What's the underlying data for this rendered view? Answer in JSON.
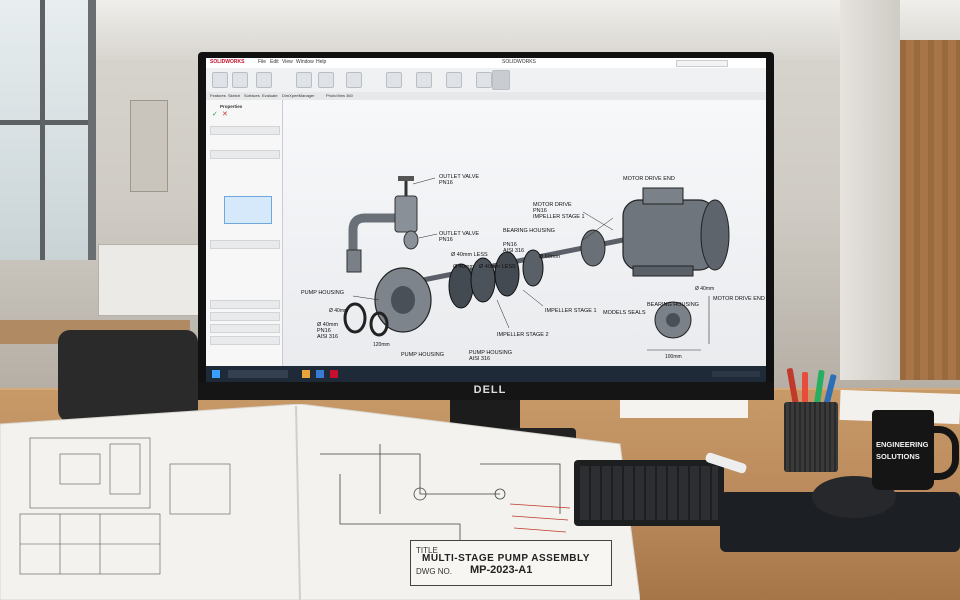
{
  "screen": {
    "app_logo": "SOLIDWORKS",
    "window_title": "SOLIDWORKS",
    "menu": [
      "File",
      "Edit",
      "View",
      "Window",
      "Help"
    ],
    "tabs": [
      "Features",
      "Sketch",
      "Surfaces",
      "Evaluate",
      "DimXpertManager",
      "PhotoView 360"
    ],
    "panel_title": "Properties",
    "callouts": [
      "OUTLET VALVE\nPN16",
      "OUTLET VALVE\nPN16",
      "MOTOR DRIVE END",
      "MOTOR DRIVE\nPN16\nIMPELLER STAGE 1",
      "BEARING HOUSING",
      "PN16\nAISI 316",
      "Ø 40mm LESS",
      "Ø 40mm",
      "Ø 60mm",
      "Ø 40mm LESS",
      "PUMP HOUSING",
      "Ø 40mm\nPN16\nAISI 316",
      "BEARING HOUSING",
      "MOTOR DRIVE END",
      "MODELS SEALS",
      "IMPELLER STAGE 1",
      "IMPELLER STAGE 2",
      "PUMP HOUSING",
      "PUMP HOUSING\nAISI 316",
      "Ø 40mm",
      "120mm",
      "Ø 40mm",
      "100mm"
    ]
  },
  "monitor_brand": "DELL",
  "blueprint": {
    "title_label": "TITLE",
    "title": "MULTI-STAGE PUMP ASSEMBLY",
    "dwg_label": "DWG NO.",
    "dwg_no": "MP-2023-A1"
  },
  "mug": {
    "line1": "ENGINEERING",
    "line2": "SOLUTIONS"
  }
}
